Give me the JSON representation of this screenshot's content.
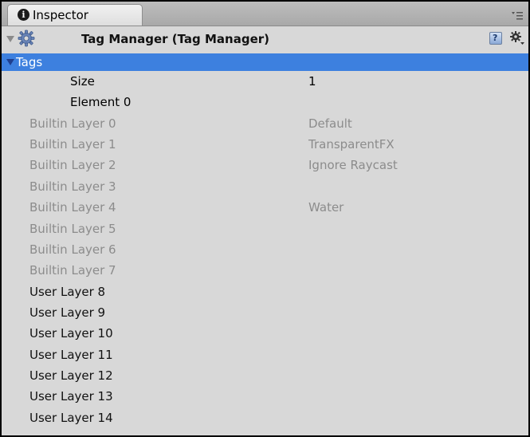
{
  "tab": {
    "label": "Inspector",
    "icon": "info-icon"
  },
  "component": {
    "title": "Tag Manager (Tag Manager)",
    "icon": "gear-icon"
  },
  "tags": {
    "label": "Tags",
    "size_label": "Size",
    "size_value": "1",
    "element_label": "Element 0",
    "element_value": ""
  },
  "layers": [
    {
      "label": "Builtin Layer 0",
      "value": "Default"
    },
    {
      "label": "Builtin Layer 1",
      "value": "TransparentFX"
    },
    {
      "label": "Builtin Layer 2",
      "value": "Ignore Raycast"
    },
    {
      "label": "Builtin Layer 3",
      "value": ""
    },
    {
      "label": "Builtin Layer 4",
      "value": "Water"
    },
    {
      "label": "Builtin Layer 5",
      "value": ""
    },
    {
      "label": "Builtin Layer 6",
      "value": ""
    },
    {
      "label": "Builtin Layer 7",
      "value": ""
    },
    {
      "label": "User Layer 8",
      "value": ""
    },
    {
      "label": "User Layer 9",
      "value": ""
    },
    {
      "label": "User Layer 10",
      "value": ""
    },
    {
      "label": "User Layer 11",
      "value": ""
    },
    {
      "label": "User Layer 12",
      "value": ""
    },
    {
      "label": "User Layer 13",
      "value": ""
    },
    {
      "label": "User Layer 14",
      "value": ""
    }
  ],
  "colors": {
    "selection": "#3d80df",
    "panel_bg": "#d8d8d8",
    "disabled_text": "#8c8c8c"
  }
}
